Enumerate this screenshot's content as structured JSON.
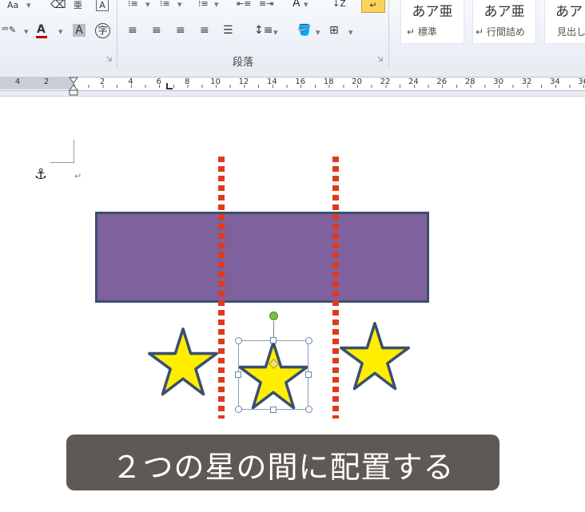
{
  "ribbon": {
    "font_group": {
      "change_case_label": "Aa",
      "enclose_char_label": "字",
      "font_color": "#c00000"
    },
    "paragraph_group": {
      "label": "段落"
    },
    "styles_group": {
      "styles": [
        {
          "sample": "あア亜",
          "name": "↵ 標準"
        },
        {
          "sample": "あア亜",
          "name": "↵ 行間詰め"
        },
        {
          "sample": "あア",
          "name": "見出し"
        }
      ]
    }
  },
  "ruler": {
    "left_labels": [
      "4",
      "2"
    ],
    "right_labels": [
      "2",
      "4",
      "6",
      "8",
      "10",
      "12",
      "14",
      "16",
      "18",
      "20",
      "22",
      "24",
      "26",
      "28",
      "30",
      "32",
      "34",
      "36"
    ]
  },
  "document": {
    "rectangle_color": "#7e619d",
    "rectangle_border": "#3b4f6f",
    "star_fill": "#ffee00",
    "star_border": "#3b4f6f",
    "guide_color": "#e03a1c"
  },
  "caption": {
    "text": "２つの星の間に配置する"
  }
}
